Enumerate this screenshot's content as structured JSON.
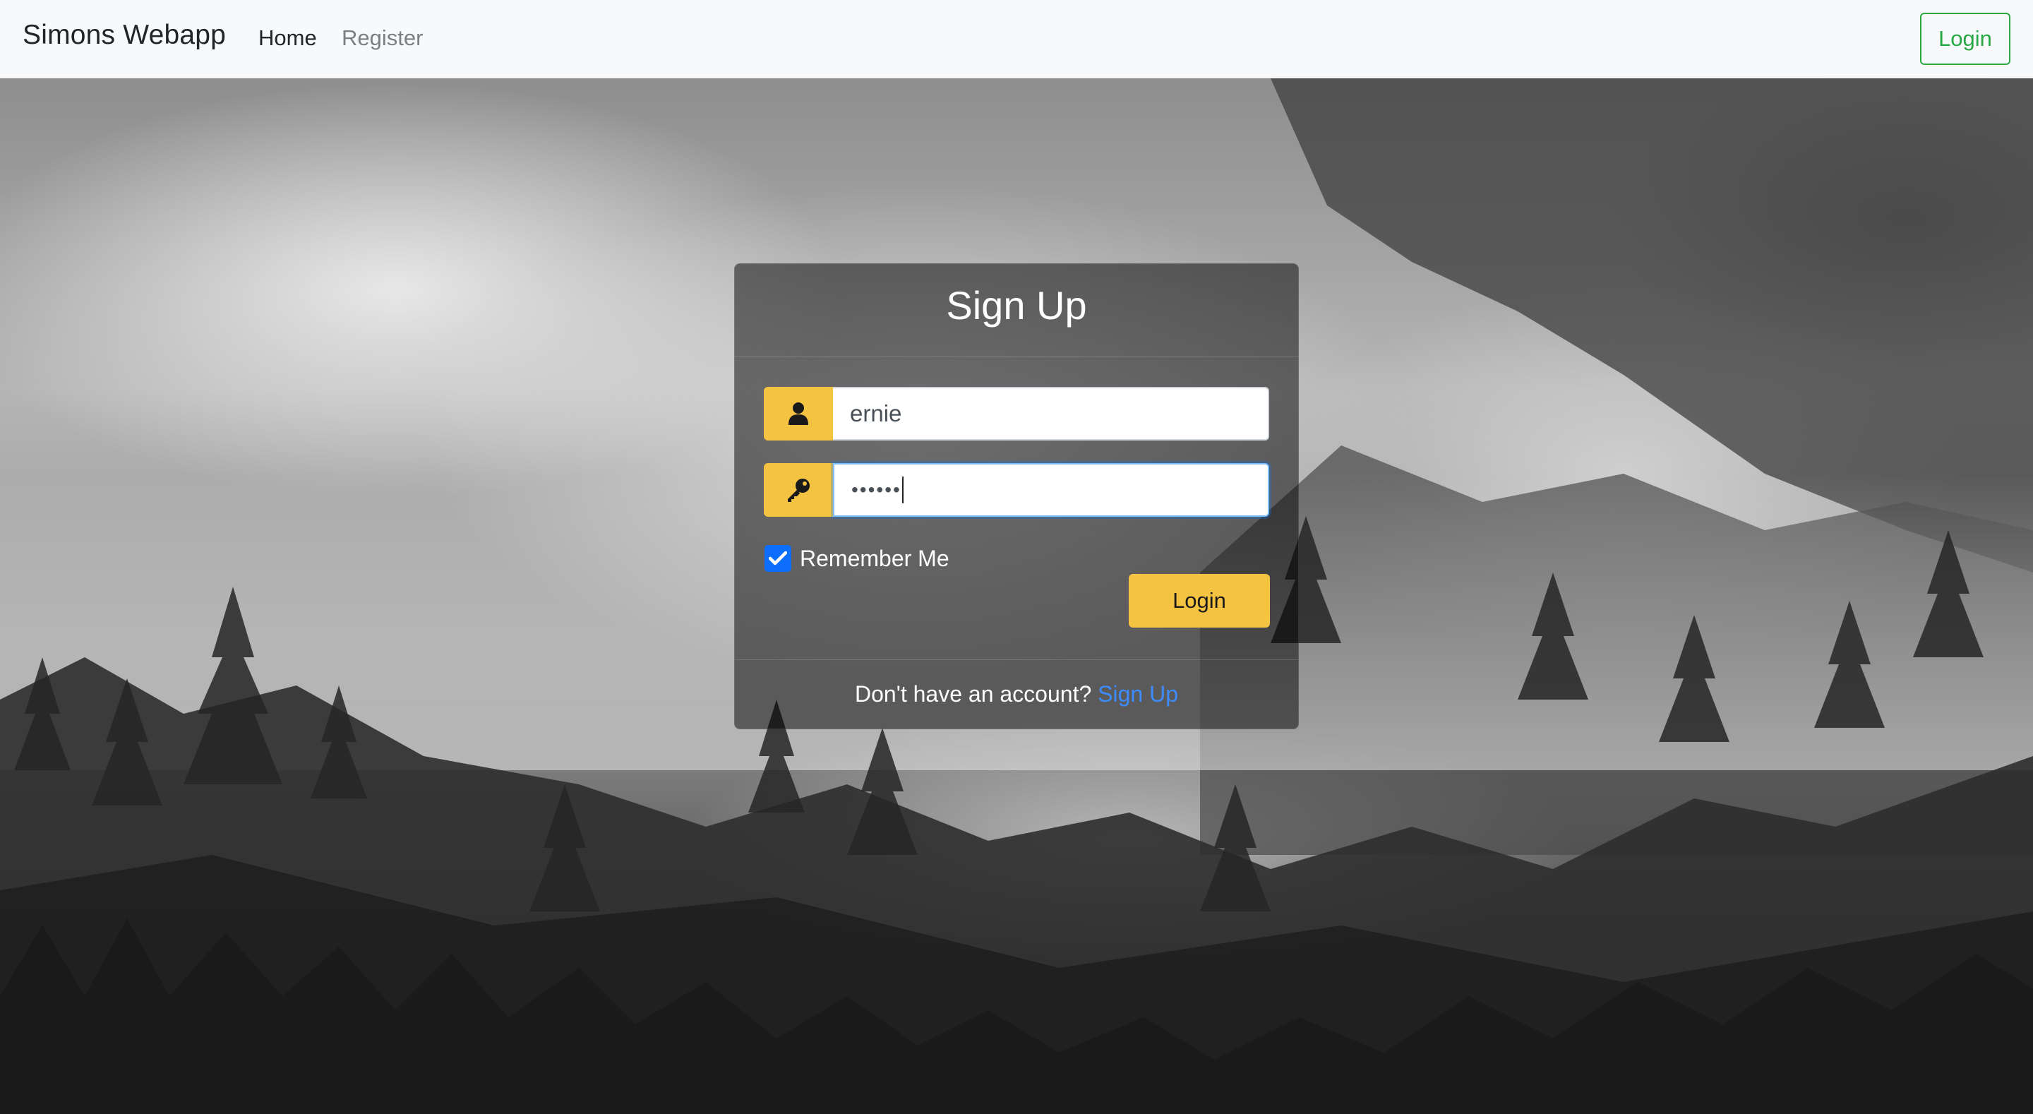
{
  "navbar": {
    "brand": "Simons Webapp",
    "links": [
      {
        "label": "Home",
        "active": true
      },
      {
        "label": "Register",
        "active": false
      }
    ],
    "login_button": "Login"
  },
  "card": {
    "title": "Sign Up",
    "username": {
      "icon": "user-icon",
      "value": "ernie"
    },
    "password": {
      "icon": "key-icon",
      "masked_value": "••••••",
      "focused": true
    },
    "remember_me": {
      "label": "Remember Me",
      "checked": true
    },
    "login_button": "Login",
    "footer": {
      "text": "Don't have an account?",
      "link": "Sign Up"
    }
  },
  "colors": {
    "accent": "#f5c342",
    "nav_login": "#28a745",
    "link": "#3d8bfd",
    "checkbox": "#0d6efd"
  }
}
